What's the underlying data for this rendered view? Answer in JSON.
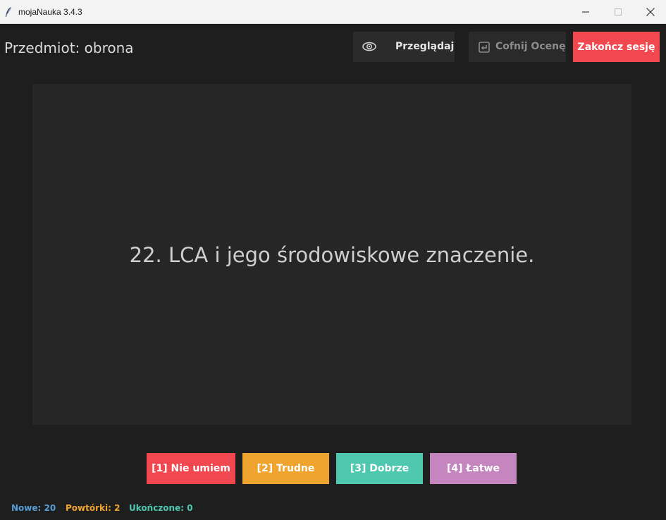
{
  "window": {
    "title": "mojaNauka 3.4.3",
    "icons": {
      "app": "feather-icon",
      "minimize": "minimize-icon",
      "maximize": "maximize-icon",
      "close": "close-icon"
    }
  },
  "header": {
    "subject": "Przedmiot: obrona",
    "browse_label": "Przeglądaj",
    "browse_icon": "eye-icon",
    "undo_label": "Cofnij Ocenę",
    "undo_icon": "undo-icon",
    "end_label": "Zakończ sesję"
  },
  "card": {
    "question": "22. LCA i jego środowiskowe znaczenie."
  },
  "ratings": {
    "again": "[1] Nie umiem",
    "hard": "[2] Trudne",
    "good": "[3] Dobrze",
    "easy": "[4] Łatwe"
  },
  "status": {
    "new": "Nowe: 20",
    "reviews": "Powtórki: 2",
    "done": "Ukończone: 0"
  },
  "colors": {
    "again": "#f1474e",
    "hard": "#f0a430",
    "good": "#4ec9b0",
    "easy": "#c586c0",
    "new": "#569cd6"
  }
}
